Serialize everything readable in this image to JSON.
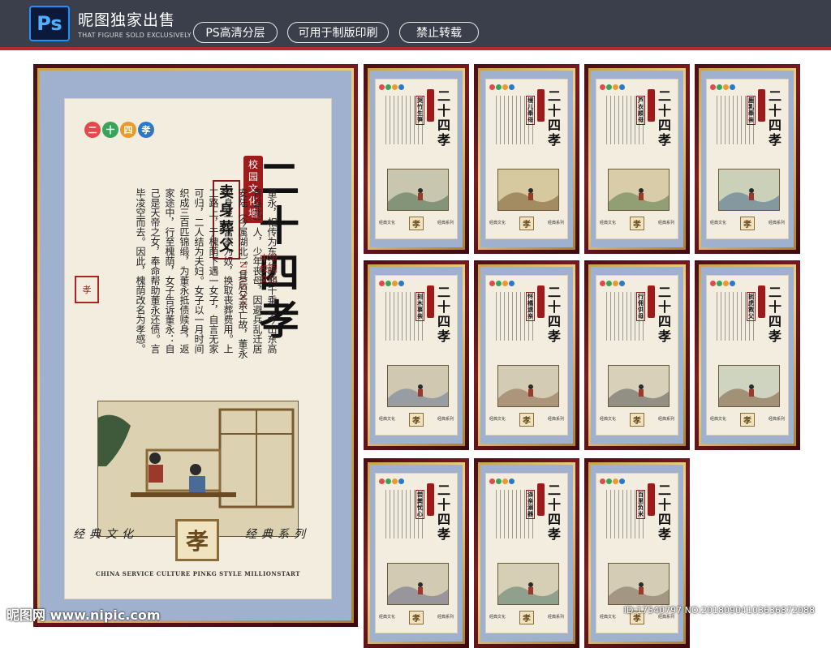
{
  "banner": {
    "logo_text": "Ps",
    "title": "昵图独家出售",
    "subtitle": "THAT FIGURE SOLD EXCLUSIVELY",
    "pills": [
      "PS高清分层",
      "可用于制版印刷",
      "禁止转载"
    ]
  },
  "big_poster": {
    "badges": [
      "二",
      "十",
      "四",
      "孝"
    ],
    "badge_colors": [
      "#e24a4a",
      "#3aa35a",
      "#e89a2a",
      "#2a78c8"
    ],
    "title": "二十四孝",
    "seal_strip": "校园文化墙",
    "subtitle": "卖身葬父",
    "stamp": "中华校园文化",
    "english_vertical": "NURSING",
    "body": "董永，相传为东汉时期千乘（今山东高青县北）人，少年丧母，因避兵乱迁居安陆（今属湖北）。其后父亲亡故，董永卖身至一富家为奴，换取丧葬费用。上工路上，于槐荫下遇一女子，自言无家可归，二人结为夫妇。女子以一月时间织成三百匹锦缎，为董永抵债赎身，返家途中，行至槐荫，女子告诉董永：自己是天帝之女，奉命帮助董永还债。言毕凌空而去。因此，槐荫改名为孝感。",
    "side_seal": "孝",
    "footer_left": "经典文化",
    "footer_right": "经典系列",
    "xiao": "孝",
    "english_footer": "CHINA SERVICE CULTURE PINKG STYLE MILLIONSTART"
  },
  "small_posters": [
    {
      "title": "二十四孝",
      "subtitle": "哭竹生笋"
    },
    {
      "title": "二十四孝",
      "subtitle": "埋儿奉母"
    },
    {
      "title": "二十四孝",
      "subtitle": "芦衣顺母"
    },
    {
      "title": "二十四孝",
      "subtitle": "鹿乳奉亲"
    },
    {
      "title": "二十四孝",
      "subtitle": "刻木事亲"
    },
    {
      "title": "二十四孝",
      "subtitle": "怀橘遗亲"
    },
    {
      "title": "二十四孝",
      "subtitle": "行佣供母"
    },
    {
      "title": "二十四孝",
      "subtitle": "扼虎救父"
    },
    {
      "title": "二十四孝",
      "subtitle": "尝粪忧心"
    },
    {
      "title": "二十四孝",
      "subtitle": "涤亲溺器"
    },
    {
      "title": "二十四孝",
      "subtitle": "百里负米"
    }
  ],
  "small_footer": {
    "left": "经典文化",
    "right": "经典系列",
    "xiao": "孝"
  },
  "watermark": "昵图网 www.nipic.com",
  "id_text": "ID:17540797 NO:20180904103636872088"
}
